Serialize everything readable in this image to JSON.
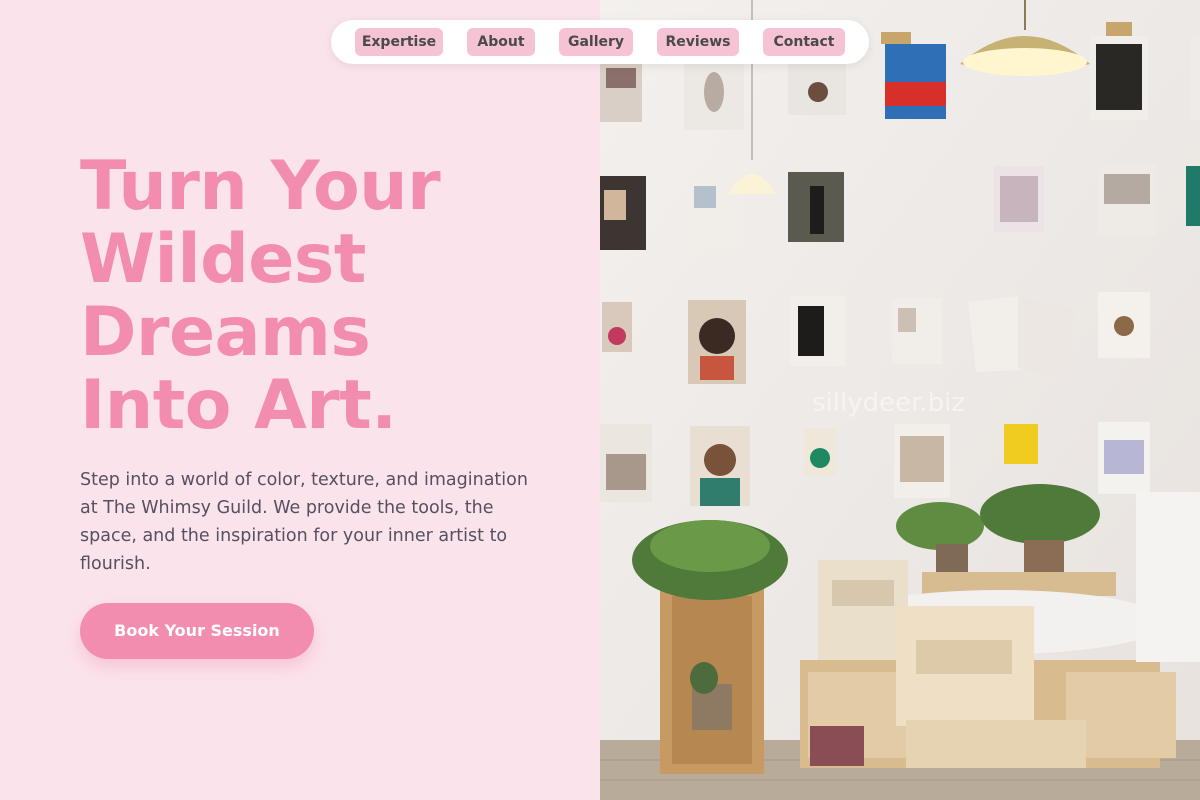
{
  "nav": {
    "items": [
      {
        "label": "Expertise"
      },
      {
        "label": "About"
      },
      {
        "label": "Gallery"
      },
      {
        "label": "Reviews"
      },
      {
        "label": "Contact"
      }
    ]
  },
  "hero": {
    "title_lines": [
      "Turn Your",
      "Wildest",
      "Dreams",
      "Into Art."
    ],
    "description": "Step into a world of color, texture, and imagination at The Whimsy Guild. We provide the tools, the space, and the inspiration for your inner artist to flourish.",
    "cta_label": "Book Your Session"
  },
  "photo": {
    "watermark": "sillydeer.biz"
  },
  "colors": {
    "accent_pink": "#f28db0",
    "background_pink": "#fbe3ec",
    "nav_pill": "#f6c3d4"
  }
}
